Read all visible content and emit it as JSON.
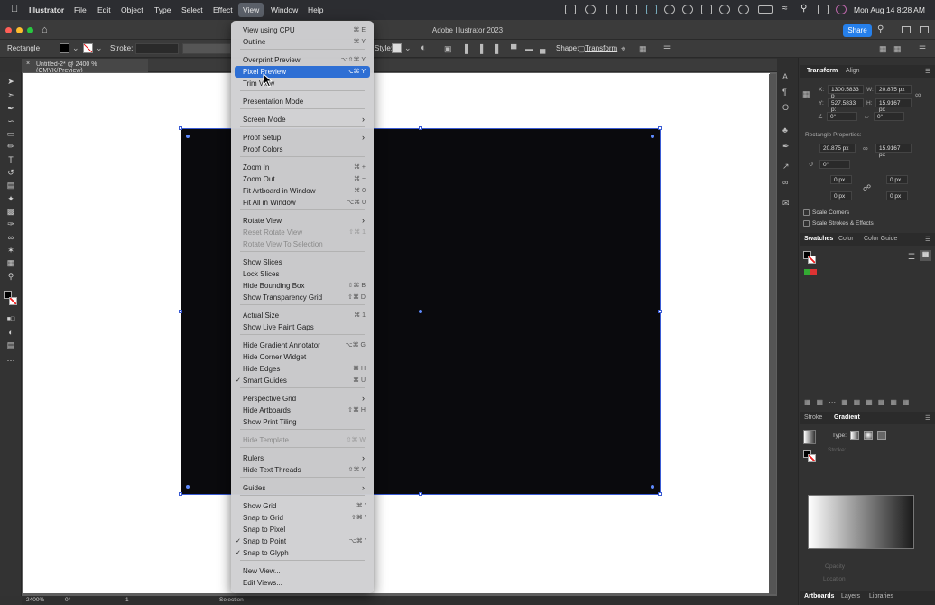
{
  "menubar": {
    "app": "Illustrator",
    "items": [
      "File",
      "Edit",
      "Object",
      "Type",
      "Select",
      "Effect",
      "View",
      "Window",
      "Help"
    ],
    "active": "View",
    "clock": "Mon Aug 14  8:28 AM"
  },
  "titlebar": {
    "title": "Adobe Illustrator 2023",
    "share": "Share"
  },
  "control": {
    "object_type": "Rectangle",
    "stroke_label": "Stroke:",
    "style_label": "Style:",
    "shape_label": "Shape:",
    "transform_label": "Transform"
  },
  "document": {
    "tab": "Untitled-2* @ 2400 % (CMYK/Preview)"
  },
  "status": {
    "zoom": "2400%",
    "rotation": "0°",
    "artboard": "1",
    "tool": "Selection"
  },
  "transform_panel": {
    "tabs": [
      "Transform",
      "Align"
    ],
    "x_label": "X:",
    "x": "1300.5833 p",
    "y_label": "Y:",
    "y": "527.5833 p:",
    "w_label": "W:",
    "w": "20.875 px",
    "h_label": "H:",
    "h": "15.9167 px",
    "angle": "0°",
    "shear": "0°",
    "rect_props": "Rectangle Properties:",
    "rect_w": "20.875 px",
    "rect_h": "15.9167 px",
    "rect_angle": "0°",
    "corner_tl": "0 px",
    "corner_tr": "0 px",
    "corner_bl": "0 px",
    "corner_br": "0 px",
    "scale_corners": "Scale Corners",
    "scale_strokes": "Scale Strokes & Effects"
  },
  "swatches_panel": {
    "tabs": [
      "Swatches",
      "Color",
      "Color Guide"
    ]
  },
  "gradient_panel": {
    "tabs": [
      "Stroke",
      "Gradient"
    ],
    "type_label": "Type:",
    "stroke_label": "Stroke:",
    "opacity_label": "Opacity",
    "location_label": "Location"
  },
  "bottom_tabs": [
    "Artboards",
    "Layers",
    "Libraries"
  ],
  "view_menu": {
    "items": [
      {
        "label": "View using CPU",
        "shortcut": "⌘ E"
      },
      {
        "label": "Outline",
        "shortcut": "⌘ Y"
      },
      {
        "label": "Overprint Preview",
        "shortcut": "⌥⇧⌘ Y"
      },
      {
        "label": "Pixel Preview",
        "shortcut": "⌥⌘ Y",
        "highlighted": true
      },
      {
        "label": "Trim View",
        "shortcut": ""
      },
      {
        "label": "Presentation Mode",
        "shortcut": ""
      },
      {
        "label": "Screen Mode",
        "shortcut": "",
        "submenu": true
      },
      {
        "label": "Proof Setup",
        "shortcut": "",
        "submenu": true
      },
      {
        "label": "Proof Colors",
        "shortcut": ""
      },
      {
        "label": "Zoom In",
        "shortcut": "⌘ +"
      },
      {
        "label": "Zoom Out",
        "shortcut": "⌘ −"
      },
      {
        "label": "Fit Artboard in Window",
        "shortcut": "⌘ 0"
      },
      {
        "label": "Fit All in Window",
        "shortcut": "⌥⌘ 0"
      },
      {
        "label": "Rotate View",
        "shortcut": "",
        "submenu": true
      },
      {
        "label": "Reset Rotate View",
        "shortcut": "⇧⌘ 1",
        "disabled": true
      },
      {
        "label": "Rotate View To Selection",
        "shortcut": "",
        "disabled": true
      },
      {
        "label": "Show Slices",
        "shortcut": ""
      },
      {
        "label": "Lock Slices",
        "shortcut": ""
      },
      {
        "label": "Hide Bounding Box",
        "shortcut": "⇧⌘ B"
      },
      {
        "label": "Show Transparency Grid",
        "shortcut": "⇧⌘ D"
      },
      {
        "label": "Actual Size",
        "shortcut": "⌘ 1"
      },
      {
        "label": "Show Live Paint Gaps",
        "shortcut": ""
      },
      {
        "label": "Hide Gradient Annotator",
        "shortcut": "⌥⌘ G"
      },
      {
        "label": "Hide Corner Widget",
        "shortcut": ""
      },
      {
        "label": "Hide Edges",
        "shortcut": "⌘ H"
      },
      {
        "label": "Smart Guides",
        "shortcut": "⌘ U",
        "checked": true
      },
      {
        "label": "Perspective Grid",
        "shortcut": "",
        "submenu": true
      },
      {
        "label": "Hide Artboards",
        "shortcut": "⇧⌘ H"
      },
      {
        "label": "Show Print Tiling",
        "shortcut": ""
      },
      {
        "label": "Hide Template",
        "shortcut": "⇧⌘ W",
        "disabled": true
      },
      {
        "label": "Rulers",
        "shortcut": "",
        "submenu": true
      },
      {
        "label": "Hide Text Threads",
        "shortcut": "⇧⌘ Y"
      },
      {
        "label": "Guides",
        "shortcut": "",
        "submenu": true
      },
      {
        "label": "Show Grid",
        "shortcut": "⌘ '"
      },
      {
        "label": "Snap to Grid",
        "shortcut": "⇧⌘ '"
      },
      {
        "label": "Snap to Pixel",
        "shortcut": ""
      },
      {
        "label": "Snap to Point",
        "shortcut": "⌥⌘ '",
        "checked": true
      },
      {
        "label": "Snap to Glyph",
        "shortcut": "",
        "checked": true
      },
      {
        "label": "New View...",
        "shortcut": ""
      },
      {
        "label": "Edit Views...",
        "shortcut": ""
      }
    ]
  },
  "colors": {
    "accent": "#2e6fd4",
    "share": "#2680eb",
    "artwork_fill": "#0a0a0d",
    "selection": "#3a5bd4"
  }
}
